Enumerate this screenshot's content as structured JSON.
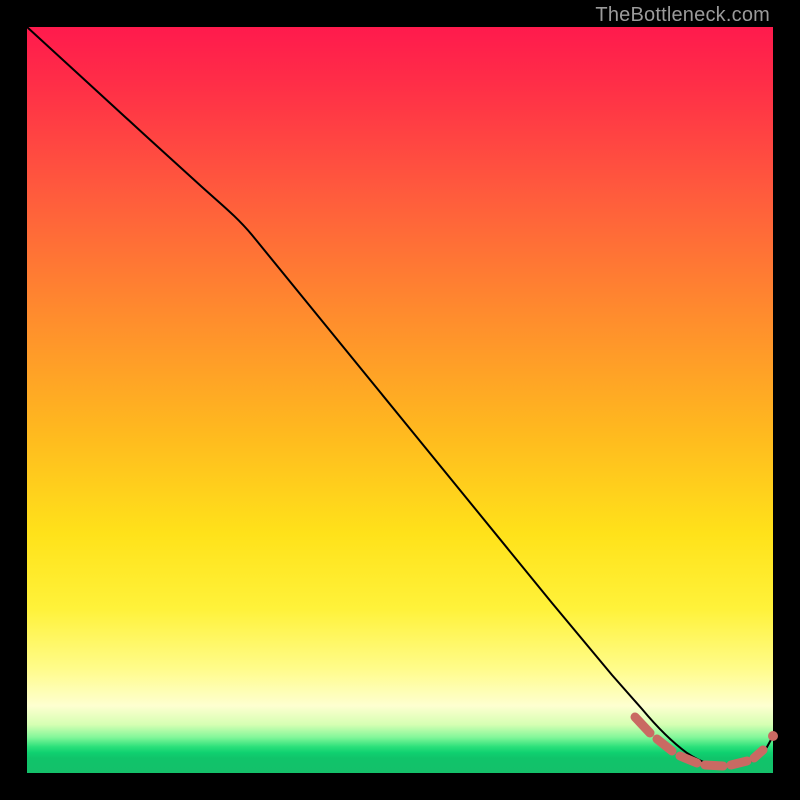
{
  "watermark": "TheBottleneck.com",
  "colors": {
    "line": "#000000",
    "accent": "#c96a63",
    "gradient_top": "#ff1a4d",
    "gradient_bottom": "#14c06a"
  },
  "chart_data": {
    "type": "line",
    "title": "",
    "xlabel": "",
    "ylabel": "",
    "xlim": [
      0,
      100
    ],
    "ylim": [
      0,
      100
    ],
    "grid": false,
    "legend": false,
    "series": [
      {
        "name": "bottleneck-curve",
        "x": [
          0,
          5,
          10,
          15,
          20,
          25,
          30,
          35,
          40,
          45,
          50,
          55,
          60,
          65,
          70,
          75,
          80,
          82,
          85,
          88,
          90,
          92,
          94,
          96,
          98,
          100
        ],
        "y": [
          100,
          94,
          88,
          82,
          77,
          72,
          67.5,
          60,
          52,
          44,
          36.5,
          29,
          22,
          15.5,
          10,
          6,
          3,
          2,
          1.2,
          1,
          1,
          1,
          1.2,
          1.8,
          3,
          5
        ]
      }
    ],
    "annotations": [
      {
        "name": "dashed-accent-segment",
        "style": "dashed",
        "color": "#c96a63",
        "x": [
          82,
          84,
          86,
          88,
          90,
          92,
          94,
          96,
          98,
          100
        ],
        "y": [
          4.0,
          3.0,
          2.2,
          1.6,
          1.2,
          1.1,
          1.2,
          1.8,
          3.0,
          5.0
        ]
      }
    ]
  }
}
